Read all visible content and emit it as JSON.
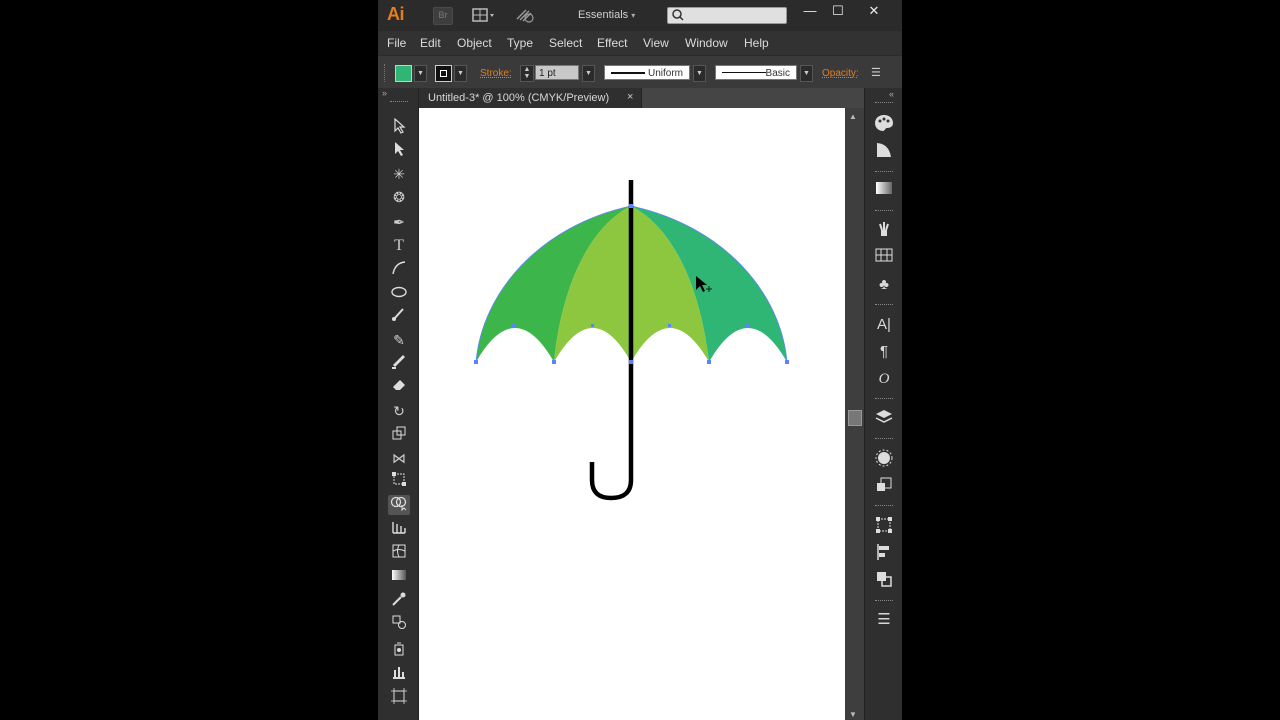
{
  "titlebar": {
    "logo": "Ai",
    "bridge": "Br",
    "workspace": "Essentials",
    "workspace_arrow": "▾",
    "minimize": "—",
    "maximize": "☐",
    "close": "✕"
  },
  "menu": [
    "File",
    "Edit",
    "Object",
    "Type",
    "Select",
    "Effect",
    "View",
    "Window",
    "Help"
  ],
  "control": {
    "fill_color": "#30b574",
    "stroke_label": "Stroke:",
    "stroke_weight": "1 pt",
    "profile_uniform": "Uniform",
    "brush_basic": "Basic",
    "opacity_label": "Opacity:"
  },
  "document": {
    "tab_title": "Untitled-3* @ 100% (CMYK/Preview)",
    "tab_close": "×"
  },
  "artwork": {
    "segment_colors": [
      "#3cb54a",
      "#8dc63f",
      "#8dc63f",
      "#2fb574"
    ],
    "handle_color": "#000000",
    "anchor_color": "#5a84ff"
  },
  "tools_header": "»",
  "dock_header": "«"
}
